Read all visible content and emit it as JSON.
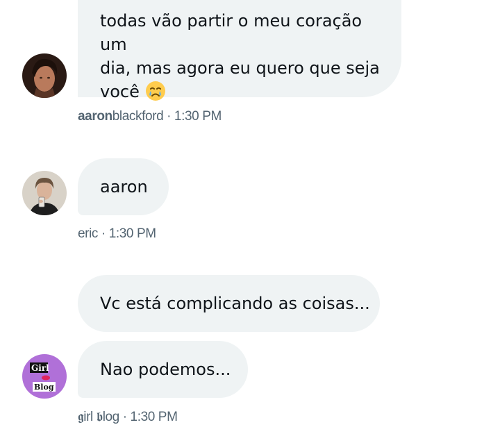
{
  "messages": [
    {
      "text_line1": "todas vão partir o meu coração um",
      "text_line2": "dia, mas agora eu quero que seja",
      "text_line3": "você",
      "emoji": "crying-face-emoji"
    },
    {
      "text": "aaron"
    },
    {
      "text": "Vc está complicando as coisas..."
    },
    {
      "text": "Nao podemos..."
    }
  ],
  "meta": {
    "aaron": {
      "name_bold": "aaron",
      "name_rest": "blackford",
      "time": " · 1:30 PM"
    },
    "eric": {
      "name": "eric",
      "time": " · 1:30 PM"
    },
    "girl": {
      "name": "𝖌irl 𝖇log",
      "time": " · 1:30 PM"
    }
  },
  "avatars": {
    "aaron": "aaron-avatar",
    "eric": "eric-avatar",
    "girl": "girl-blog-avatar",
    "girl_text_top": "Girl",
    "girl_text_bottom": "Blog"
  },
  "colors": {
    "bubble": "#eff3f4",
    "text": "#0f1419",
    "meta": "#536471",
    "girl_avatar_bg": "#b070d8"
  }
}
